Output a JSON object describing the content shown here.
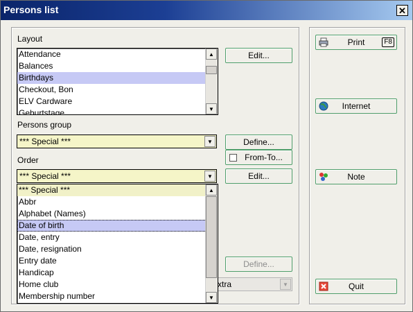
{
  "window": {
    "title": "Persons list",
    "close_label": "✕"
  },
  "layout_section": {
    "label": "Layout",
    "items": [
      "Attendance",
      "Balances",
      "Birthdays",
      "Checkout, Bon",
      "ELV Cardware",
      "Geburtstage"
    ],
    "selected": "Birthdays",
    "edit_button": "Edit..."
  },
  "persons_group": {
    "label": "Persons group",
    "value": "*** Special ***",
    "define_button": "Define...",
    "from_to_label": "From-To..."
  },
  "order_section": {
    "label": "Order",
    "value": "*** Special ***",
    "edit_button": "Edit...",
    "dropdown_items": [
      "*** Special ***",
      "Abbr",
      "Alphabet (Names)",
      "Date of birth",
      "Date, entry",
      "Date, resignation",
      "Entry date",
      "Handicap",
      "Home club",
      "Membership number"
    ],
    "highlighted": "*** Special ***",
    "selected": "Date of birth"
  },
  "hidden_controls": {
    "define_button": "Define...",
    "combo_partial_text": "xtra"
  },
  "right_panel": {
    "print_button": "Print",
    "print_shortcut": "F8",
    "internet_button": "Internet",
    "note_button": "Note",
    "quit_button": "Quit"
  },
  "colors": {
    "selection": "#c6c9f5",
    "combo_bg": "#f5f5c8",
    "button_border": "#4f9e6b",
    "title_start": "#0a246a",
    "title_end": "#a6caf0"
  }
}
